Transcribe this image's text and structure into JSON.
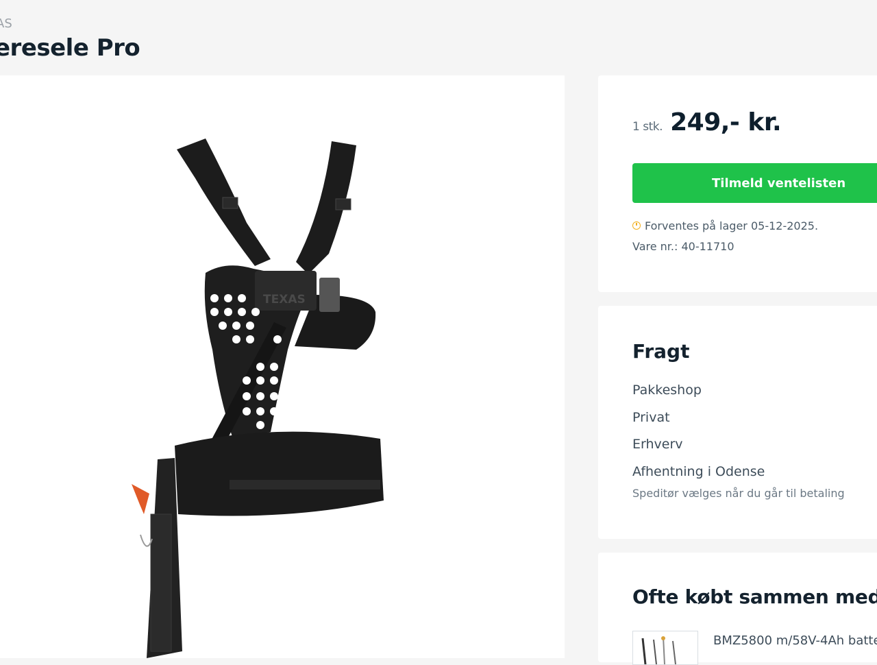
{
  "breadcrumb": {
    "brand": "AS"
  },
  "product": {
    "title": "eresele Pro",
    "image_logo_text": "TEXAS"
  },
  "purchase": {
    "quantity_label": "1 stk.",
    "price": "249,- kr.",
    "waitlist_button": "Tilmeld ventelisten",
    "stock_text": "Forventes på lager 05-12-2025.",
    "sku_text": "Vare nr.: 40-11710"
  },
  "freight": {
    "title": "Fragt",
    "options": [
      "Pakkeshop",
      "Privat",
      "Erhverv",
      "Afhentning i Odense"
    ],
    "note": "Speditør vælges når du går til betaling"
  },
  "related": {
    "title": "Ofte købt sammen med",
    "items": [
      {
        "name": "BMZ5800 m/58V-4Ah batte"
      }
    ]
  },
  "colors": {
    "accent_green": "#1fc24a",
    "stock_clock": "#f2b01e",
    "background": "#f5f5f5",
    "heading": "#14222e"
  }
}
